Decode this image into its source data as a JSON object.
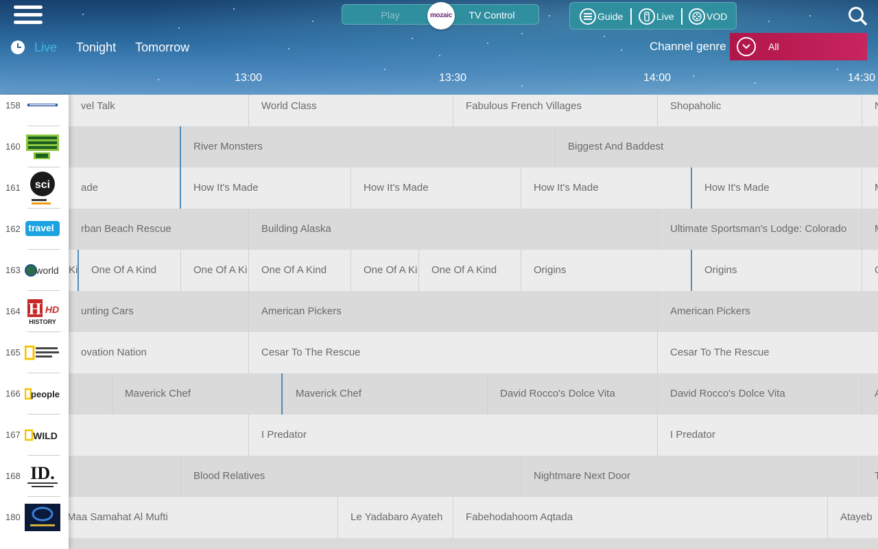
{
  "header": {
    "mode_toggle": {
      "left": "Play",
      "right": "TV Control",
      "knob": "mozaic"
    },
    "nav": {
      "guide": "Guide",
      "live": "Live",
      "vod": "VOD"
    },
    "tabs": [
      "Live",
      "Tonight",
      "Tomorrow"
    ],
    "genre": {
      "label": "Channel genre",
      "value": "All"
    },
    "times": [
      "13:00",
      "13:30",
      "14:00",
      "14:30"
    ]
  },
  "channels": [
    {
      "num": "158",
      "logo": "discovery-logo-small"
    },
    {
      "num": "160",
      "logo": "animal-planet-hd-logo",
      "text": "ANIMAL PLANET HD"
    },
    {
      "num": "161",
      "logo": "discovery-science-logo",
      "text": "sci"
    },
    {
      "num": "162",
      "logo": "travel-channel-logo",
      "text": "travel"
    },
    {
      "num": "163",
      "logo": "discovery-world-logo",
      "text": "world"
    },
    {
      "num": "164",
      "logo": "history-hd-logo",
      "text": "HISTORY"
    },
    {
      "num": "165",
      "logo": "national-geographic-logo",
      "text": "NATIONAL GEOGRAPHIC CHANNEL"
    },
    {
      "num": "166",
      "logo": "natgeo-people-logo",
      "text": "people"
    },
    {
      "num": "167",
      "logo": "natgeo-wild-logo",
      "text": "WILD"
    },
    {
      "num": "168",
      "logo": "investigation-discovery-logo",
      "text": "ID."
    },
    {
      "num": "180",
      "logo": "arabic-channel-logo"
    }
  ],
  "programs": [
    [
      "vel Talk",
      "World Class",
      "Fabulous French Villages",
      "Shopaholic",
      "N"
    ],
    [
      "",
      "River Monsters",
      "Biggest And Baddest"
    ],
    [
      "ade",
      "How It's Made",
      "How It's Made",
      "How It's Made",
      "How It's Made",
      "M"
    ],
    [
      "rban Beach Rescue",
      "Building Alaska",
      "Ultimate Sportsman's Lodge: Colorado",
      "M"
    ],
    [
      "Ki",
      "One Of A Kind",
      "One Of A Ki",
      "One Of A Kind",
      "One Of A Ki",
      "One Of A Kind",
      "Origins",
      "Origins",
      "O"
    ],
    [
      "unting Cars",
      "American Pickers",
      "American Pickers"
    ],
    [
      "ovation Nation",
      "Cesar To The Rescue",
      "Cesar To The Rescue"
    ],
    [
      "",
      "Maverick Chef",
      "Maverick Chef",
      "David Rocco's Dolce Vita",
      "David Rocco's Dolce Vita",
      "A"
    ],
    [
      "",
      "I Predator",
      "I Predator"
    ],
    [
      "",
      "Blood Relatives",
      "Nightmare Next Door",
      "T"
    ],
    [
      "Maa Samahat Al Mufti",
      "Le Yadabaro Ayateh",
      "Fabehodahoom Aqtada",
      "Atayeb"
    ]
  ]
}
